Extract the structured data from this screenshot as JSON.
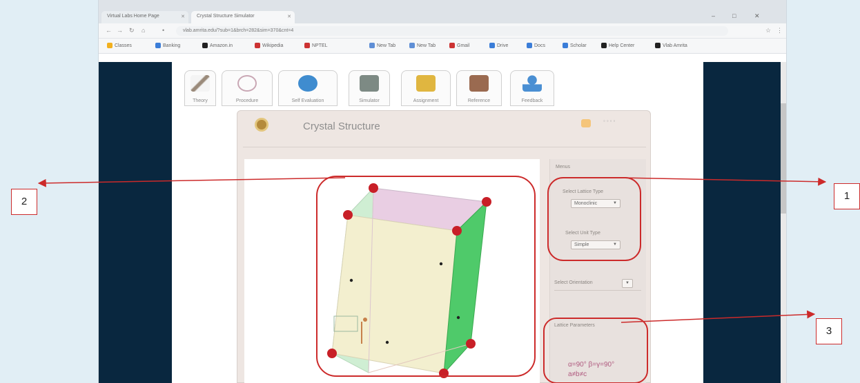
{
  "browser": {
    "tabs": [
      {
        "label": "Virtual Labs Home Page",
        "active": false
      },
      {
        "label": "Crystal Structure Simulator",
        "active": true
      }
    ],
    "window_controls": [
      "–",
      "□",
      "✕"
    ],
    "url": "vlab.amrita.edu/?sub=1&brch=282&sim=370&cnt=4",
    "bookmarks": [
      {
        "label": "Classes",
        "color": "#f2b01e"
      },
      {
        "label": "Banking",
        "color": "#3b7dd8"
      },
      {
        "label": "Amazon.in",
        "color": "#222222"
      },
      {
        "label": "Wikipedia",
        "color": "#cc3333"
      },
      {
        "label": "NPTEL",
        "color": "#cc3333"
      },
      {
        "label": "New Tab",
        "color": "#5f8fd6"
      },
      {
        "label": "New Tab",
        "color": "#5f8fd6"
      },
      {
        "label": "Gmail",
        "color": "#cc3333"
      },
      {
        "label": "Drive",
        "color": "#3b7dd8"
      },
      {
        "label": "Docs",
        "color": "#3b7dd8"
      },
      {
        "label": "Scholar",
        "color": "#3b7dd8"
      },
      {
        "label": "Help Center",
        "color": "#222222"
      },
      {
        "label": "Vlab Amrita",
        "color": "#222222"
      }
    ]
  },
  "lab_tabs": [
    {
      "label": "Theory",
      "icon": "pencil-icon",
      "color": "#9a8a7a"
    },
    {
      "label": "Procedure",
      "icon": "flask-icon",
      "color": "#c9a7b4"
    },
    {
      "label": "Self Evaluation",
      "icon": "mouse-icon",
      "color": "#3f8ccf"
    },
    {
      "label": "Simulator",
      "icon": "monitor-icon",
      "color": "#7d8a84"
    },
    {
      "label": "Assignment",
      "icon": "book-icon",
      "color": "#e0b640"
    },
    {
      "label": "Reference",
      "icon": "bookshelf-icon",
      "color": "#9a6a50"
    },
    {
      "label": "Feedback",
      "icon": "person-icon",
      "color": "#4a8fd3"
    }
  ],
  "simulation": {
    "title": "Crystal Structure",
    "menu_heading": "Menus",
    "lattice_label": "Select Lattice Type",
    "lattice_value": "Monoclinic",
    "unit_label": "Select Unit Type",
    "unit_value": "Simple",
    "show_label": "Select Orientation",
    "params_heading": "Lattice Parameters",
    "param_line1": "α=90° β=γ=90°",
    "param_line2": "a≠b≠c"
  },
  "annotations": [
    {
      "number": "1"
    },
    {
      "number": "2"
    },
    {
      "number": "3"
    }
  ],
  "colors": {
    "annotation": "#cc2a2a",
    "atom": "#c81f27",
    "sidebar": "#09273f"
  }
}
